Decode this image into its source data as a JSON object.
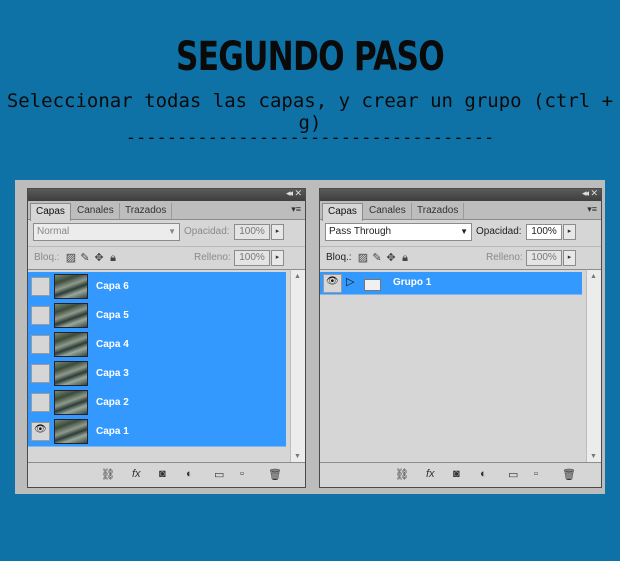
{
  "header": {
    "title": "SEGUNDO PASO",
    "subtitle": "Seleccionar todas las capas, y crear un grupo (ctrl + g)",
    "divider": "------------------------------------"
  },
  "left_panel": {
    "tabs": [
      "Capas",
      "Canales",
      "Trazados"
    ],
    "blend_mode": "Normal",
    "opacity_label": "Opacidad:",
    "opacity_value": "100%",
    "lock_label": "Bloq.:",
    "fill_label": "Relleno:",
    "fill_value": "100%",
    "layers": [
      {
        "name": "Capa 6",
        "visible": false
      },
      {
        "name": "Capa 5",
        "visible": false
      },
      {
        "name": "Capa 4",
        "visible": false
      },
      {
        "name": "Capa 3",
        "visible": false
      },
      {
        "name": "Capa 2",
        "visible": false
      },
      {
        "name": "Capa 1",
        "visible": true
      }
    ]
  },
  "right_panel": {
    "tabs": [
      "Capas",
      "Canales",
      "Trazados"
    ],
    "blend_mode": "Pass Through",
    "opacity_label": "Opacidad:",
    "opacity_value": "100%",
    "lock_label": "Bloq.:",
    "fill_label": "Relleno:",
    "fill_value": "100%",
    "group": {
      "name": "Grupo 1",
      "visible": true
    }
  },
  "icons": {
    "eye": "eye-icon",
    "link": "link-layers-icon",
    "fx": "fx-icon",
    "mask": "add-mask-icon",
    "adjustment": "adjustment-layer-icon",
    "folder": "new-group-icon",
    "new_layer": "new-layer-icon",
    "trash": "delete-layer-icon"
  },
  "colors": {
    "background": "#0f72a7",
    "selection": "#3399ff"
  }
}
